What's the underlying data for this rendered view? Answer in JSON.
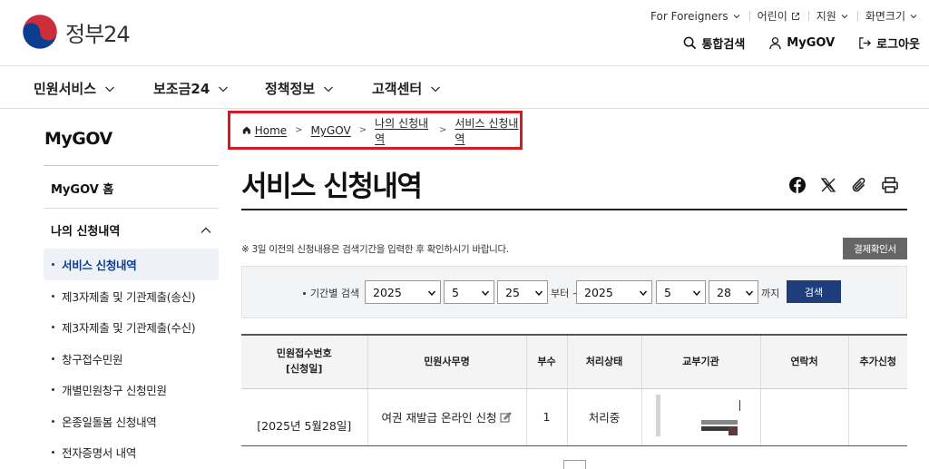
{
  "brand": {
    "name": "정부24"
  },
  "util": {
    "foreigners": "For Foreigners",
    "kids": "어린이",
    "support": "지원",
    "font_size": "화면크기"
  },
  "main_links": {
    "search": "통합검색",
    "mygov": "MyGOV",
    "logout": "로그아웃"
  },
  "gnb": [
    "민원서비스",
    "보조금24",
    "정책정보",
    "고객센터"
  ],
  "lnb": {
    "title": "MyGOV",
    "home": "MyGOV 홈",
    "group": "나의 신청내역",
    "items": [
      "서비스 신청내역",
      "제3자제출 및 기관제출(송신)",
      "제3자제출 및 기관제출(수신)",
      "창구접수민원",
      "개별민원창구 신청민원",
      "온종일돌봄 신청내역",
      "전자증명서 내역"
    ]
  },
  "breadcrumb": [
    "Home",
    "MyGOV",
    "나의 신청내역",
    "서비스 신청내역"
  ],
  "page_title": "서비스 신청내역",
  "notice": "※ 3일 이전의 신청내용은 검색기간을 입력한 후 확인하시기 바랍니다.",
  "pay_button": "결제확인서",
  "search": {
    "label": "기간별 검색",
    "from_year": "2025",
    "from_month": "5",
    "from_day": "25",
    "from_suffix": "부터 ~",
    "to_year": "2025",
    "to_month": "5",
    "to_day": "28",
    "to_suffix": "까지",
    "button": "검색"
  },
  "table": {
    "headers": [
      "민원접수번호",
      "[신청일]",
      "민원사무명",
      "부수",
      "처리상태",
      "교부기관",
      "연락처",
      "추가신청"
    ],
    "row": {
      "date": "[2025년 5월28일]",
      "service": "여권 재발급 온라인 신청",
      "copies": "1",
      "status": "처리중"
    }
  },
  "colors": {
    "highlight_border": "#d71920",
    "search_button": "#1f3d7a",
    "active_menu": "#0b3d91"
  }
}
